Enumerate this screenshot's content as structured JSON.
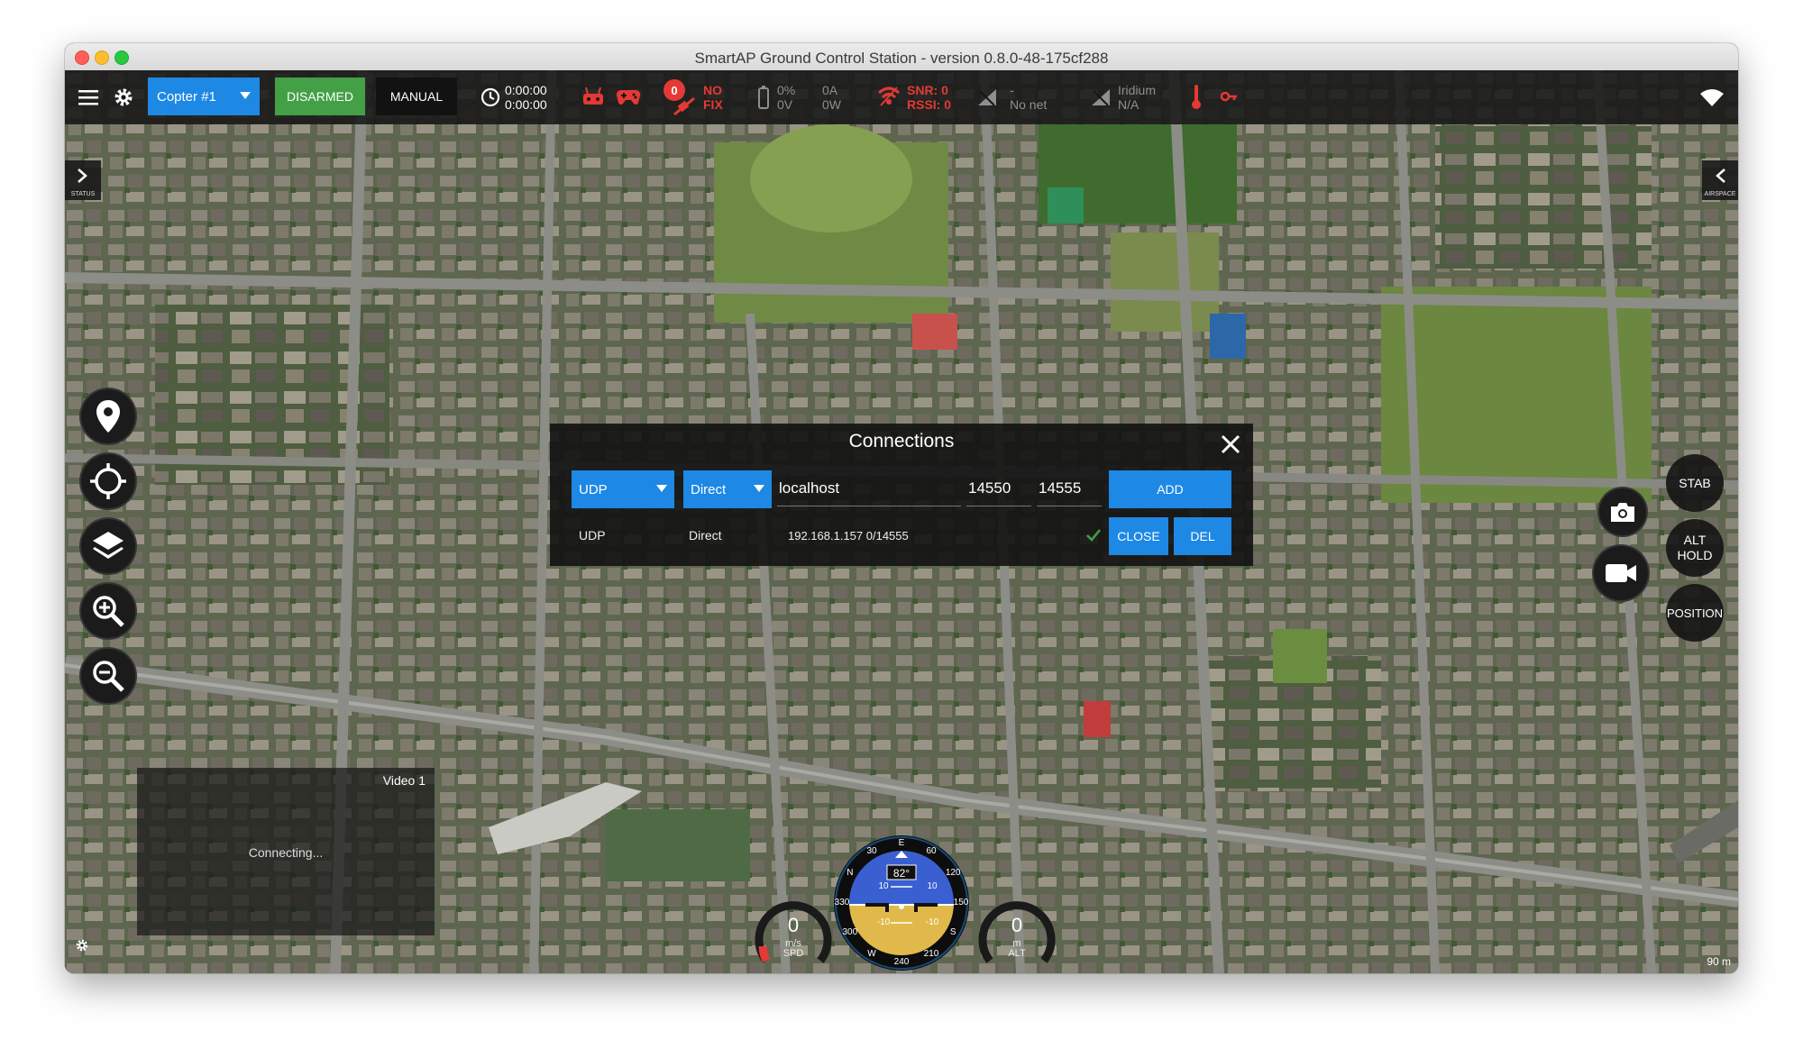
{
  "window": {
    "title": "SmartAP Ground Control Station - version 0.8.0-48-175cf288"
  },
  "toolbar": {
    "vehicle": "Copter #1",
    "arm_state": "DISARMED",
    "flight_mode": "MANUAL",
    "timer1": "0:00:00",
    "timer2": "0:00:00",
    "gps_count": "0",
    "gps_status_line1": "NO",
    "gps_status_line2": "FIX",
    "battery_pct": "0%",
    "battery_volt": "0V",
    "battery_amp": "0A",
    "battery_watt": "0W",
    "snr": "SNR: 0",
    "rssi": "RSSI: 0",
    "net_dash": "-",
    "net_status": "No net",
    "iridium_label": "Iridium",
    "iridium_status": "N/A"
  },
  "side_tabs": {
    "left": "STATUS",
    "right": "AIRSPACE"
  },
  "modes": {
    "stab": "STAB",
    "alt_hold_line1": "ALT",
    "alt_hold_line2": "HOLD",
    "position": "POSITION"
  },
  "connections": {
    "title": "Connections",
    "protocol": "UDP",
    "mode": "Direct",
    "host": "localhost",
    "port_local": "14550",
    "port_remote": "14555",
    "add_label": "ADD",
    "existing": {
      "protocol": "UDP",
      "mode": "Direct",
      "address": "192.168.1.157 0/14555"
    },
    "close_label": "CLOSE",
    "del_label": "DEL"
  },
  "video": {
    "label": "Video 1",
    "status": "Connecting..."
  },
  "hud": {
    "heading": "82°",
    "speed_value": "0",
    "speed_unit": "m/s",
    "speed_label": "SPD",
    "alt_value": "0",
    "alt_unit": "m",
    "alt_label": "ALT",
    "compass_labels": [
      "E",
      "60",
      "120",
      "150",
      "S",
      "210",
      "240",
      "W",
      "300",
      "330",
      "N",
      "30"
    ],
    "pitch_labels": [
      "10",
      "10",
      "-10",
      "-10"
    ]
  },
  "map": {
    "scale": "90 m"
  },
  "colors": {
    "accent": "#1e88e5",
    "armed_state": "#43a047",
    "alert": "#e53935",
    "toolbar": "#161616"
  }
}
